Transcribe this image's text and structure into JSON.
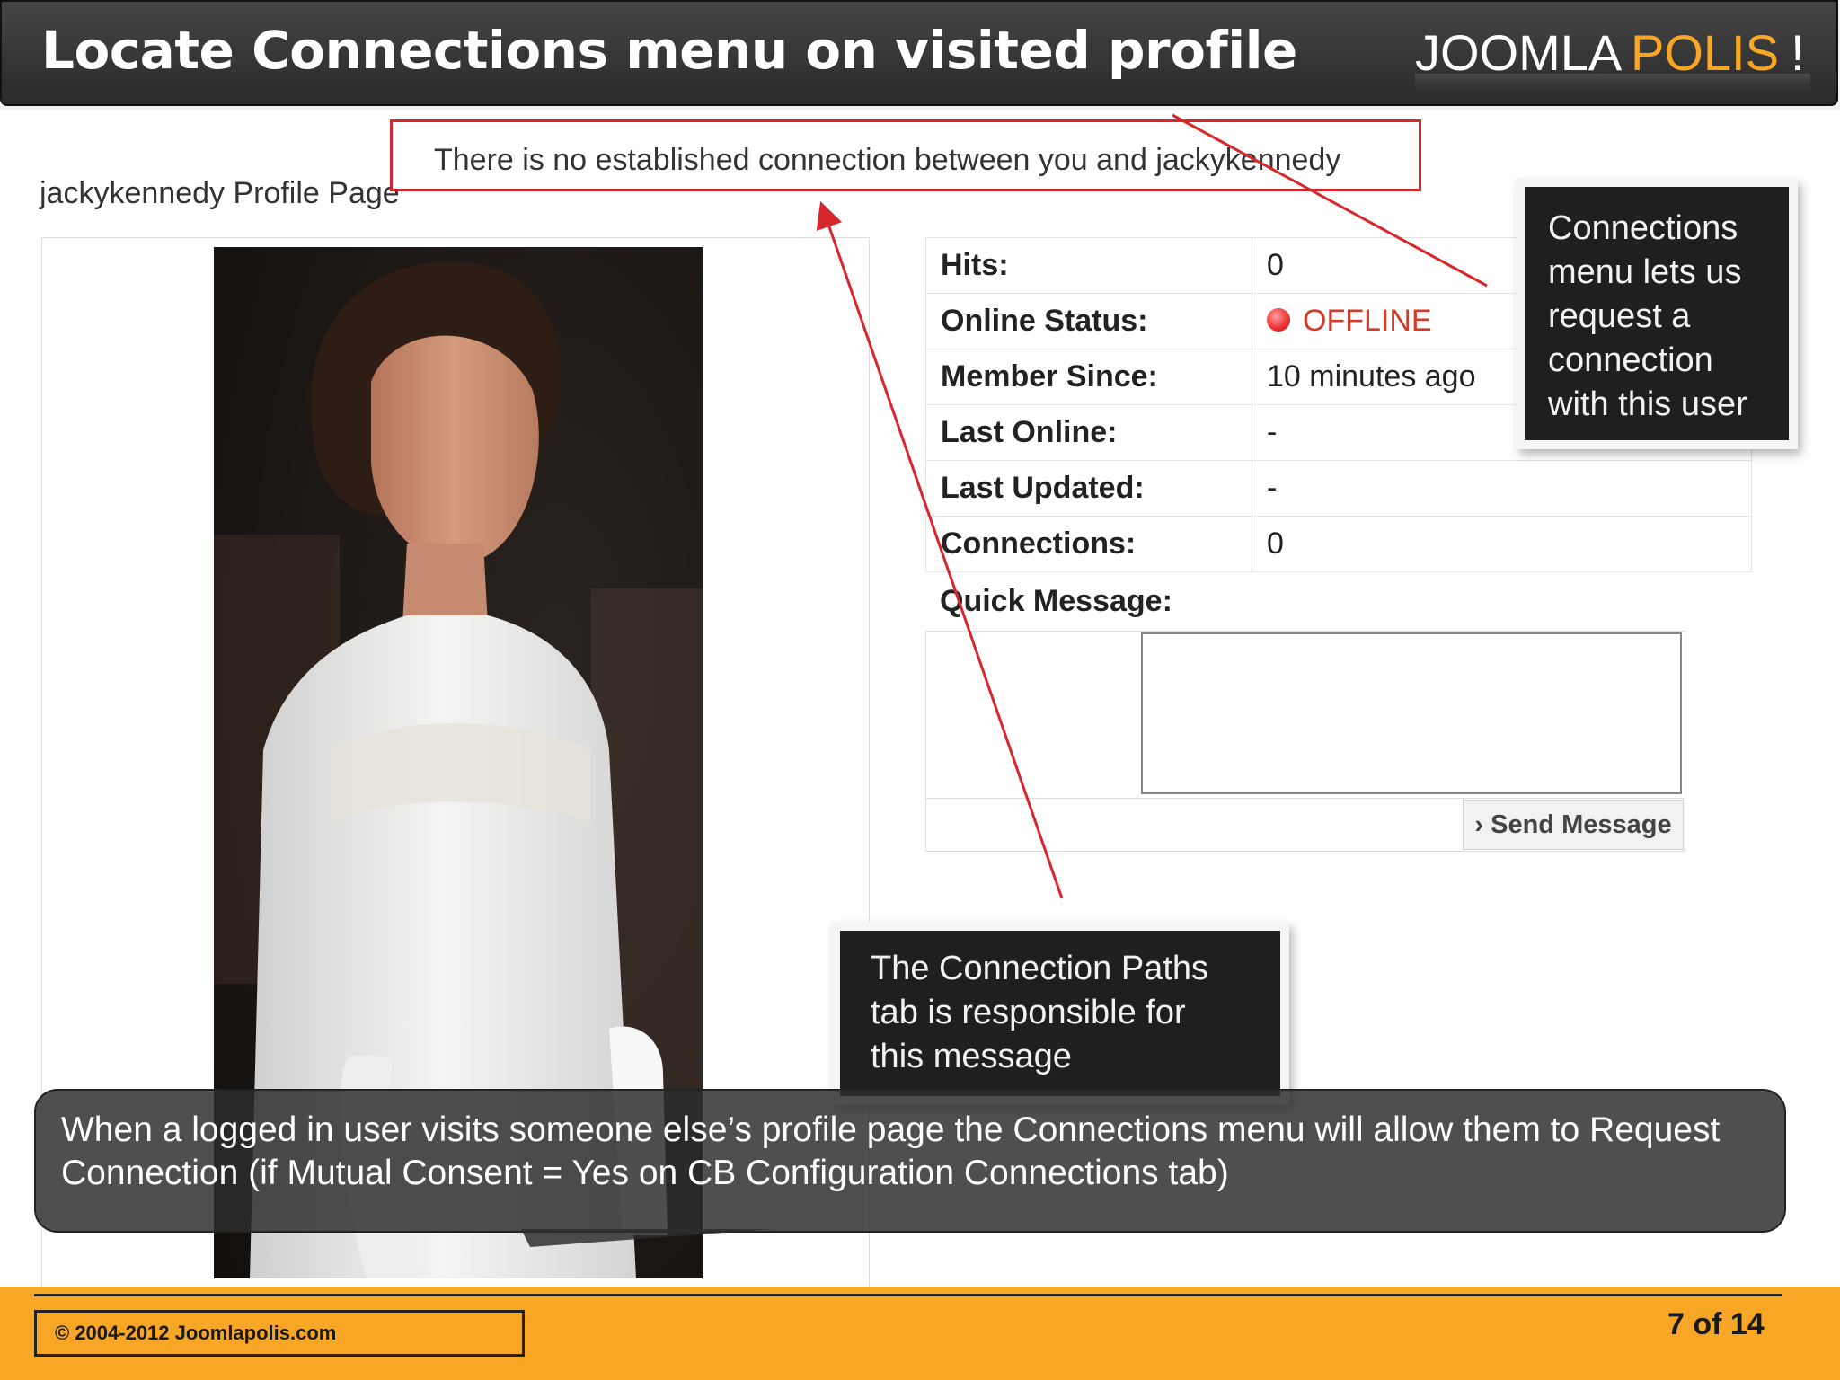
{
  "slide": {
    "title": "Locate Connections menu on visited profile",
    "logo": {
      "part1": "JOOMLA",
      "part2": "POLIS",
      "part3": "!"
    }
  },
  "profile": {
    "page_title": "jackykennedy Profile Page",
    "notice": "There is no established connection between you and jackykennedy",
    "fields": [
      {
        "label": "Hits:",
        "value": "0"
      },
      {
        "label": "Online Status:",
        "value": "OFFLINE"
      },
      {
        "label": "Member Since:",
        "value": "10 minutes ago"
      },
      {
        "label": "Last Online:",
        "value": "-"
      },
      {
        "label": "Last Updated:",
        "value": "-"
      },
      {
        "label": "Connections:",
        "value": "0"
      }
    ],
    "quick_message_label": "Quick Message:",
    "send_button": "Send Message"
  },
  "callouts": {
    "connections": [
      "Connections",
      "menu lets us",
      "request a",
      "connection",
      "with this user"
    ],
    "paths": [
      "The Connection Paths",
      "tab is responsible for",
      "this message"
    ]
  },
  "caption": {
    "line1": "When a logged in user visits someone else’s profile page the Connections menu will allow them to Request",
    "line2": "Connection (if Mutual Consent = Yes on CB Configuration Connections tab)"
  },
  "footer": {
    "copyright": "© 2004-2012 Joomlapolis.com",
    "page": "7 of 14"
  },
  "colors": {
    "accent_orange": "#f7a626",
    "notice_red": "#d9262d",
    "header_dark": "#333333"
  }
}
